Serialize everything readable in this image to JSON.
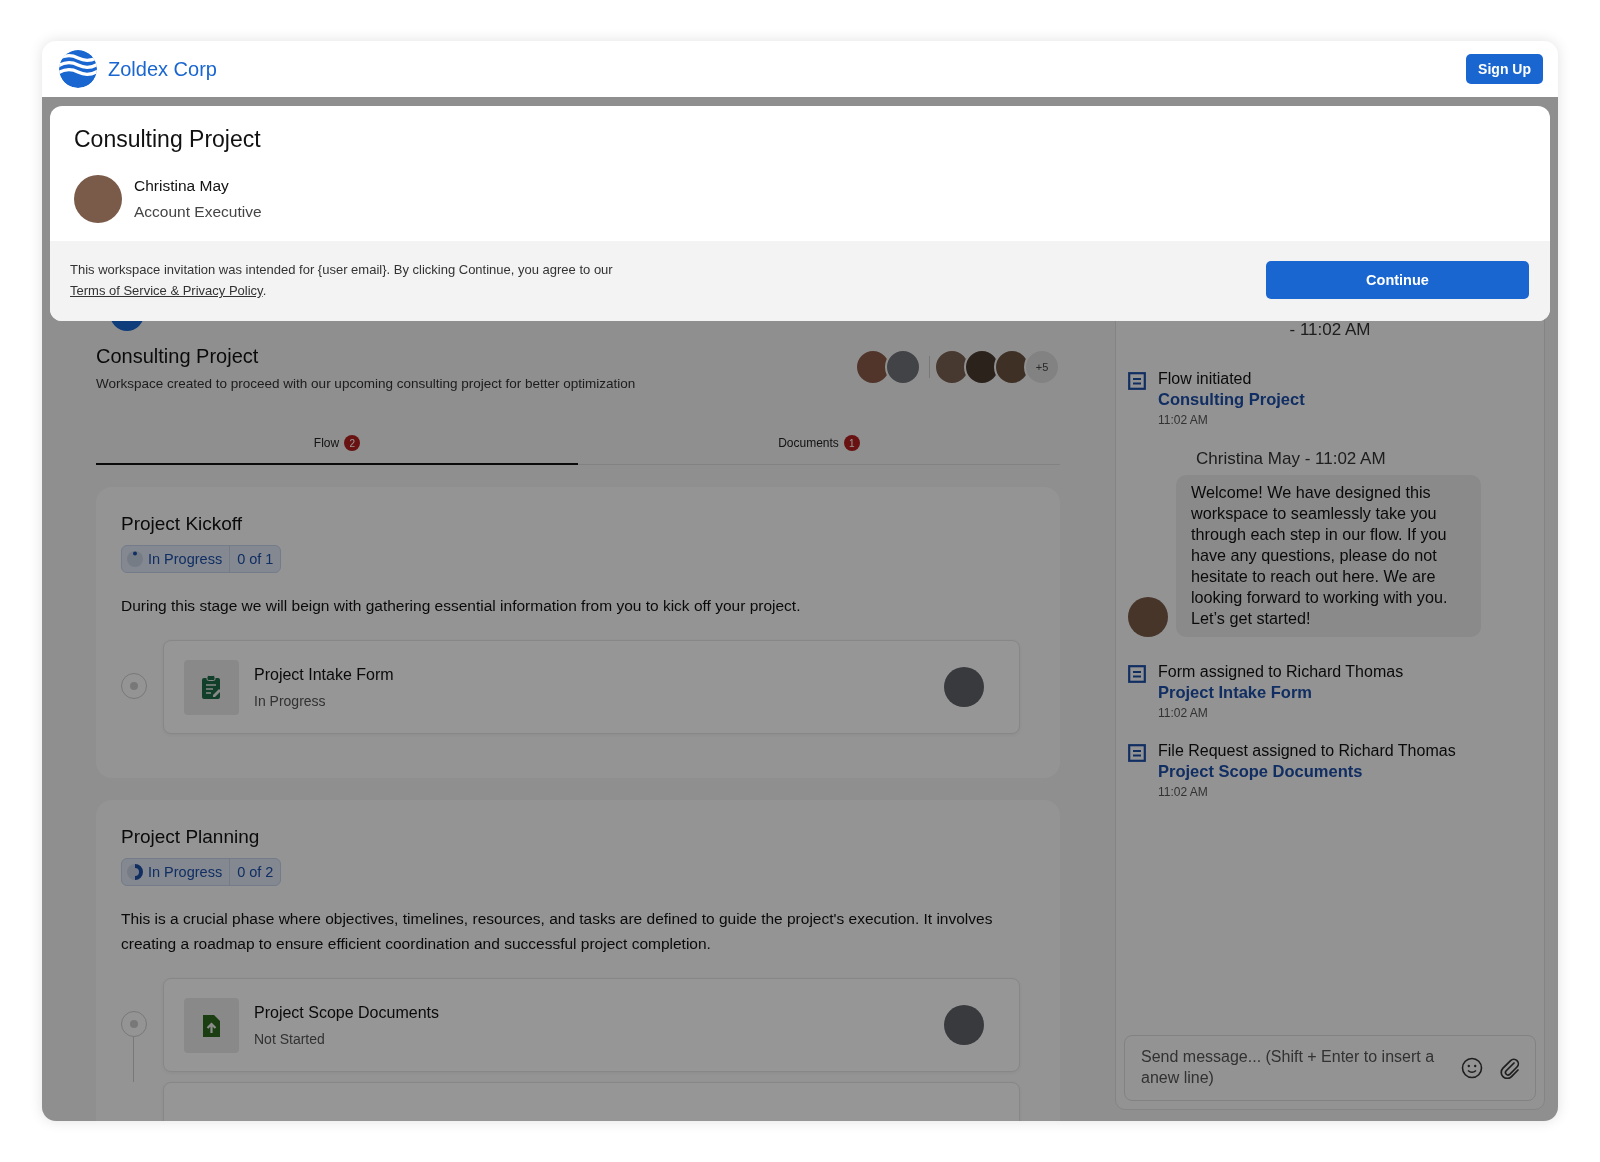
{
  "header": {
    "brand": "Zoldex Corp",
    "sign_up": "Sign Up"
  },
  "modal": {
    "title": "Consulting Project",
    "person": {
      "name": "Christina May",
      "role": "Account Executive"
    },
    "notice": "This workspace invitation was intended for {user email}. By clicking Continue, you agree to our ",
    "notice_link": "Terms of Service & Privacy Policy",
    "notice_end": ".",
    "continue": "Continue"
  },
  "workspace": {
    "title": "Consulting Project",
    "description": "Workspace created to proceed with our upcoming consulting project for better optimization",
    "more_members": "+5"
  },
  "tabs": [
    {
      "label": "Flow",
      "count": "2",
      "selected": true
    },
    {
      "label": "Documents",
      "count": "1",
      "selected": false
    }
  ],
  "stages": [
    {
      "title": "Project Kickoff",
      "status": "In Progress",
      "progress": "0 of 1",
      "kind": "started",
      "description": "During this stage we will beign with gathering essential information from you to kick off your project.",
      "tasks": [
        {
          "kind": "form",
          "title": "Project Intake Form",
          "status": "In Progress",
          "selected": false
        }
      ]
    },
    {
      "title": "Project Planning",
      "status": "In Progress",
      "progress": "0 of 2",
      "kind": "halfway",
      "description": "This is a crucial phase where objectives, timelines, resources, and tasks are defined to guide the project's execution. It involves creating a roadmap to ensure efficient coordination and successful project completion.",
      "tasks": [
        {
          "kind": "upload",
          "title": "Project Scope Documents",
          "status": "Not Started",
          "selected": false
        },
        {
          "kind": "clipped"
        }
      ]
    }
  ],
  "chat": {
    "top_time": "- 11:02 AM",
    "items": [
      {
        "kind": "event",
        "text": "Flow initiated",
        "link": "Consulting Project",
        "time": "11:02 AM"
      },
      {
        "kind": "message",
        "sender": "Christina May - 11:02 AM",
        "text": "Welcome! We have designed this workspace to seamlessly take you through each step in our flow. If you have any questions, please do not hesitate to reach out here. We are looking forward to working with you. Let’s get started!"
      },
      {
        "kind": "event",
        "text": "Form assigned to Richard Thomas",
        "link": "Project Intake Form",
        "time": "11:02 AM"
      },
      {
        "kind": "event",
        "text": "File Request assigned to Richard Thomas",
        "link": "Project Scope Documents",
        "time": "11:02 AM"
      }
    ],
    "placeholder": "Send message... (Shift + Enter to insert a anew line)"
  }
}
